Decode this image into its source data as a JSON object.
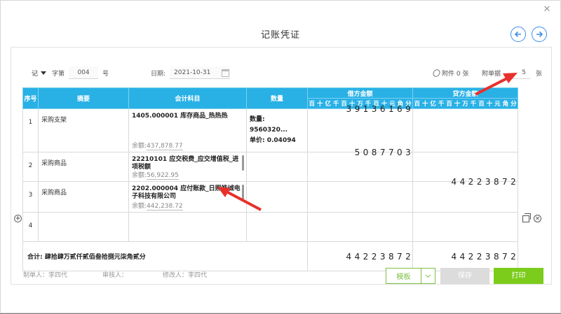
{
  "title": "记账凭证",
  "header": {
    "voucher_type": "记",
    "word_label": "字第",
    "number": "004",
    "number_suffix": "号",
    "date_label": "日期:",
    "date_value": "2021-10-31",
    "attachment_label": "附件 0 张",
    "doc_count_label": "附单据",
    "doc_count_value": "5",
    "doc_count_unit": "张"
  },
  "table": {
    "col_seq": "序号",
    "col_summary": "摘要",
    "col_account": "会计科目",
    "col_qty": "数量",
    "col_debit": "借方金额",
    "col_credit": "贷方金额",
    "digit_labels": [
      "百",
      "十",
      "亿",
      "千",
      "百",
      "十",
      "万",
      "千",
      "百",
      "十",
      "元",
      "角",
      "分"
    ],
    "rows": [
      {
        "idx": "1",
        "summary": "采购支架",
        "account": "1405.000001 库存商品_热热热",
        "balance_label": "余额:",
        "balance": "437,878.77",
        "qty_line1": "数量: 9560320...",
        "qty_line2": "单价: 0.04094",
        "debit": "39136169",
        "credit": ""
      },
      {
        "idx": "2",
        "summary": "采购商品",
        "account": "22210101 应交税费_应交增值税_进项税额",
        "balance_label": "余额:",
        "balance": "56,922.95",
        "qty_line1": "",
        "qty_line2": "",
        "debit": "5087703",
        "credit": ""
      },
      {
        "idx": "3",
        "summary": "采购商品",
        "account": "2202.000004 应付账款_日照皓诚电子科技有限公司",
        "balance_label": "余额:",
        "balance": "442,238.72",
        "qty_line1": "",
        "qty_line2": "",
        "debit": "",
        "credit": "44223872"
      },
      {
        "idx": "4",
        "summary": "",
        "account": "",
        "balance_label": "",
        "balance": "",
        "qty_line1": "",
        "qty_line2": "",
        "debit": "",
        "credit": ""
      }
    ],
    "total_label": "合计:  肆拾肆万贰仟贰佰叁拾捌元柒角贰分",
    "total_debit": "44223872",
    "total_credit": "44223872"
  },
  "footer": {
    "maker": "制单人：李四代",
    "auditor": "审核人：",
    "modifier": "修改人：李四代",
    "template_btn": "模板",
    "save_btn": "保存",
    "print_btn": "打印"
  },
  "colors": {
    "header_blue": "#29b1e6",
    "accent_green": "#7ccc1c",
    "arrow_red": "#e8302a",
    "nav_blue": "#3e8ee8"
  }
}
